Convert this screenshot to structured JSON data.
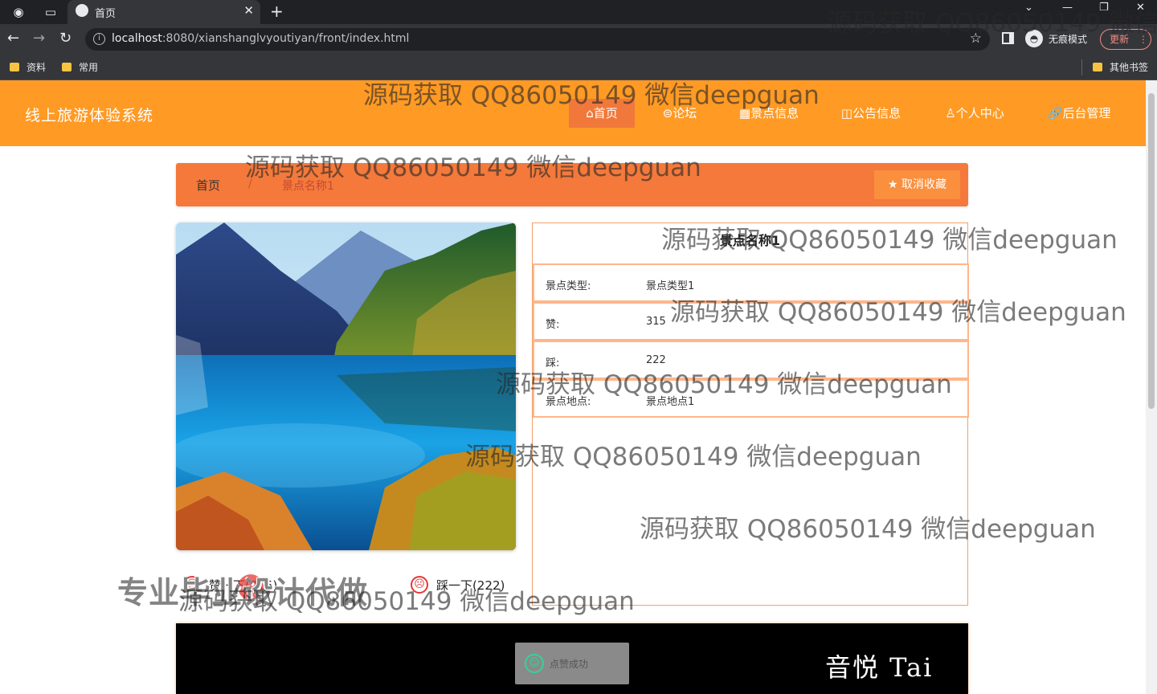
{
  "browser": {
    "tab_title": "首页",
    "url_host": "localhost",
    "url_rest": ":8080/xianshanglvyoutiyan/front/index.html",
    "incognito_label": "无痕模式",
    "update_label": "更新",
    "bookmarks": [
      "资料",
      "常用"
    ],
    "other_bookmarks": "其他书签"
  },
  "site": {
    "title": "线上旅游体验系统",
    "nav": [
      {
        "label": "⌂首页"
      },
      {
        "label": "⊜论坛"
      },
      {
        "label": "▦景点信息"
      },
      {
        "label": "◫公告信息"
      },
      {
        "label": "♙个人中心"
      },
      {
        "label": "🔗后台管理"
      }
    ]
  },
  "breadcrumb": {
    "home": "首页",
    "separator": "/",
    "current": "景点名称1",
    "favorite_label": "取消收藏"
  },
  "detail": {
    "title": "景点名称1",
    "rows": [
      {
        "label": "景点类型:",
        "value": "景点类型1"
      },
      {
        "label": "赞:",
        "value": "315"
      },
      {
        "label": "踩:",
        "value": "222"
      },
      {
        "label": "景点地点:",
        "value": "景点地点1"
      }
    ]
  },
  "actions": {
    "like": "赞一下(315)",
    "dislike": "踩一下(222)"
  },
  "video": {
    "brand": "音悦 Tai"
  },
  "toast": {
    "message": "点赞成功"
  },
  "overlay": {
    "promo": "专业毕业设计代做",
    "watermark": "源码获取 QQ86050149 微信deepguan"
  },
  "colors": {
    "header": "#ff9a24",
    "breadcrumb": "#f4793b",
    "border": "#f4a06a"
  }
}
